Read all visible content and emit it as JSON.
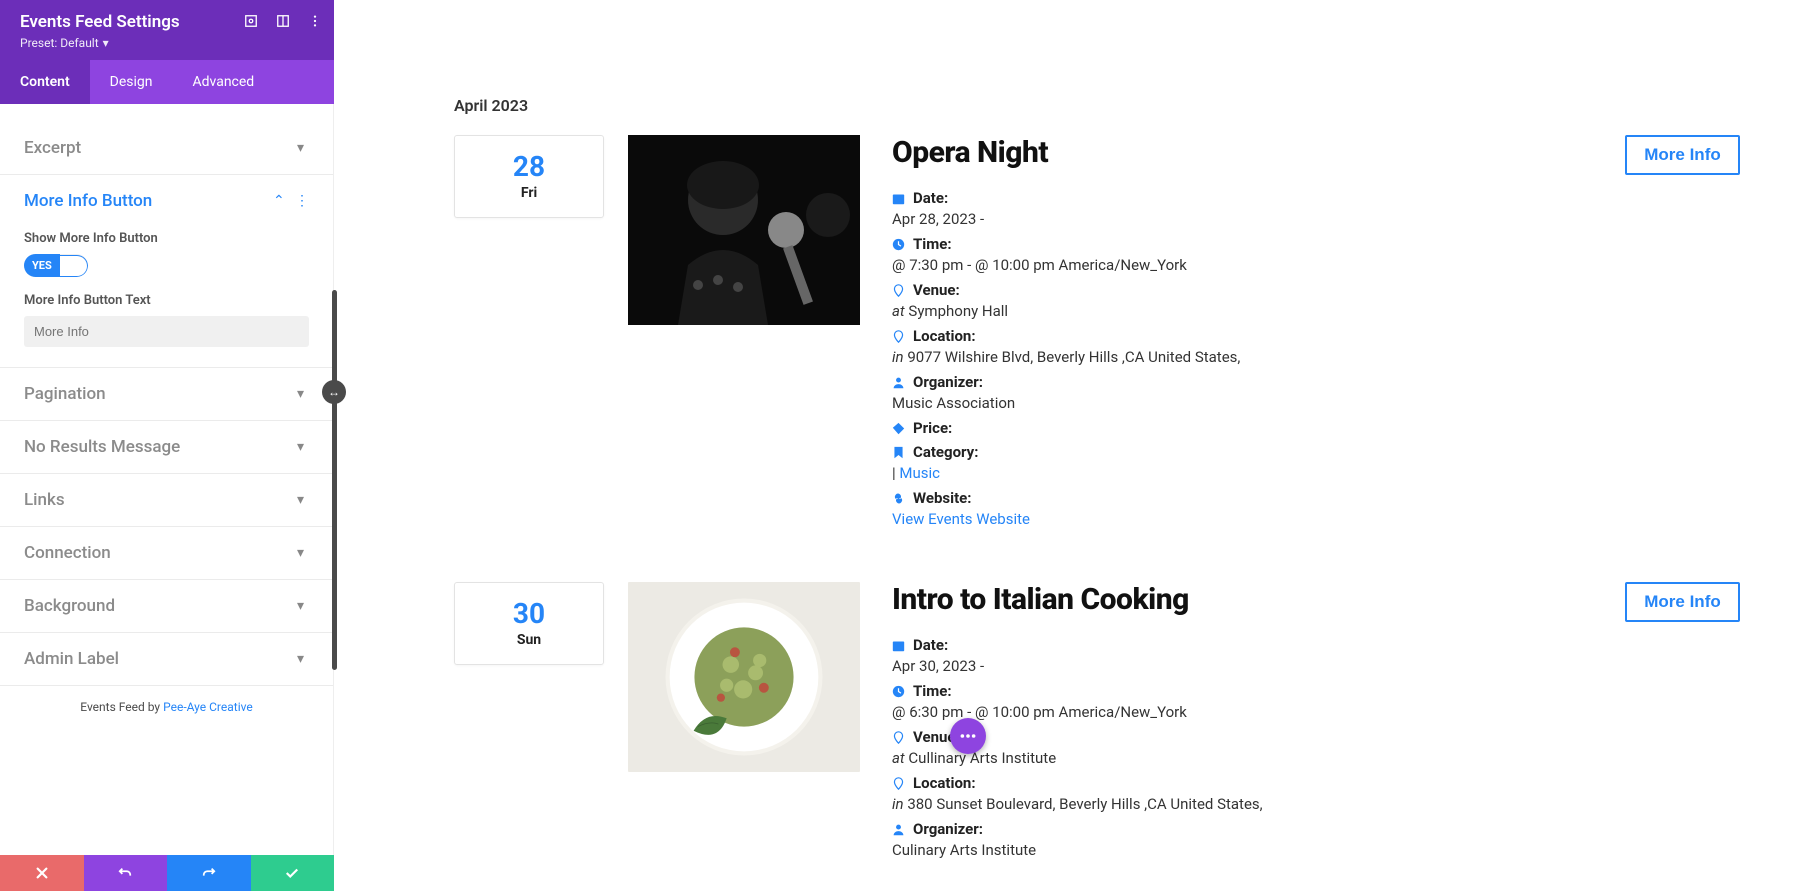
{
  "sidebar": {
    "title": "Events Feed Settings",
    "preset_label": "Preset: Default",
    "tabs": {
      "content": "Content",
      "design": "Design",
      "advanced": "Advanced"
    },
    "sections": {
      "excerpt": "Excerpt",
      "more_info_button": "More Info Button",
      "pagination": "Pagination",
      "no_results": "No Results Message",
      "links": "Links",
      "connection": "Connection",
      "background": "Background",
      "admin_label": "Admin Label"
    },
    "show_more_info_label": "Show More Info Button",
    "toggle_yes": "YES",
    "more_info_text_label": "More Info Button Text",
    "more_info_placeholder": "More Info",
    "credit_prefix": "Events Feed by ",
    "credit_link": "Pee-Aye Creative"
  },
  "canvas": {
    "month": "April 2023",
    "events": [
      {
        "day_num": "28",
        "day_abbr": "Fri",
        "title": "Opera Night",
        "date_label": "Date:",
        "date_value": "Apr 28, 2023 -",
        "time_label": "Time:",
        "time_value": "@ 7:30 pm - @ 10:00 pm America/New_York",
        "venue_label": "Venue:",
        "venue_prefix": "at",
        "venue_value": "Symphony Hall",
        "location_label": "Location:",
        "location_prefix": "in",
        "location_value": "9077 Wilshire Blvd, Beverly Hills ,CA United States,",
        "organizer_label": "Organizer:",
        "organizer_value": "Music Association",
        "price_label": "Price:",
        "category_label": "Category:",
        "category_sep": "|",
        "category_link": "Music",
        "website_label": "Website:",
        "website_link": "View Events Website",
        "more_info": "More Info"
      },
      {
        "day_num": "30",
        "day_abbr": "Sun",
        "title": "Intro to Italian Cooking",
        "date_label": "Date:",
        "date_value": "Apr 30, 2023 -",
        "time_label": "Time:",
        "time_value": "@ 6:30 pm - @ 10:00 pm America/New_York",
        "venue_label": "Venue:",
        "venue_prefix": "at",
        "venue_value": "Cullinary Arts Institute",
        "location_label": "Location:",
        "location_prefix": "in",
        "location_value": "380 Sunset Boulevard, Beverly Hills ,CA United States,",
        "organizer_label": "Organizer:",
        "organizer_value": "Culinary Arts Institute",
        "more_info": "More Info"
      }
    ]
  }
}
